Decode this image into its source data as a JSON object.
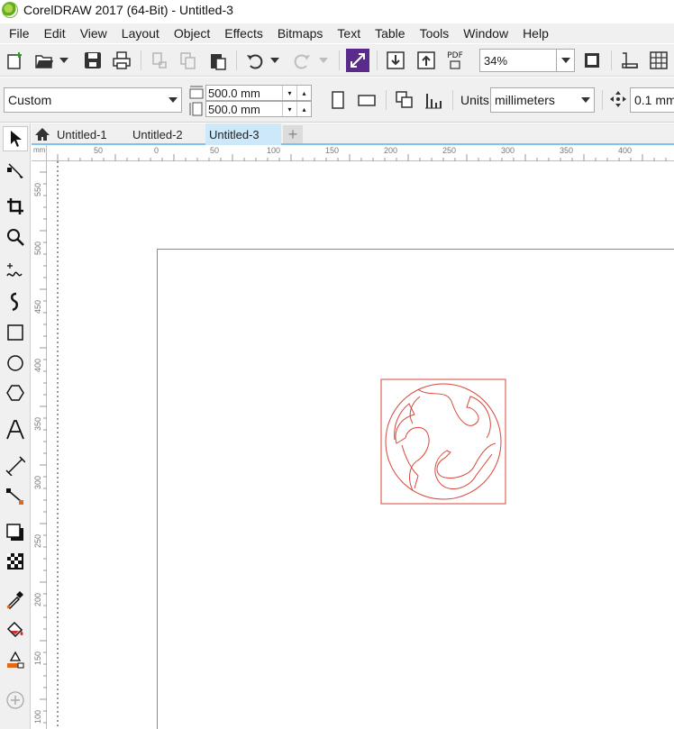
{
  "window": {
    "title": "CorelDRAW 2017 (64-Bit) - Untitled-3"
  },
  "menu": [
    "File",
    "Edit",
    "View",
    "Layout",
    "Object",
    "Effects",
    "Bitmaps",
    "Text",
    "Table",
    "Tools",
    "Window",
    "Help"
  ],
  "toolbar": {
    "pdf_label": "PDF",
    "zoom": "34%"
  },
  "property_bar": {
    "page_size": "Custom",
    "width": "500.0 mm",
    "height": "500.0 mm",
    "units_label": "Units:",
    "units": "millimeters",
    "nudge": "0.1 mm"
  },
  "tabs": [
    {
      "label": "Untitled-1",
      "active": false
    },
    {
      "label": "Untitled-2",
      "active": false
    },
    {
      "label": "Untitled-3",
      "active": true
    }
  ],
  "ruler": {
    "corner": "mm",
    "horizontal": [
      "50",
      "0",
      "50",
      "100",
      "150",
      "200",
      "250",
      "300",
      "350",
      "400"
    ],
    "vertical": [
      "550",
      "500",
      "450",
      "400",
      "350",
      "300",
      "250",
      "200",
      "150",
      "100"
    ]
  },
  "colors": {
    "accent_tab": "#cde8f8",
    "drawing_stroke": "#d9473a",
    "toolbar_bg": "#f0f0f0"
  },
  "icons": {
    "toolbox": [
      "pick-tool-icon",
      "shape-tool-icon",
      "crop-tool-icon",
      "zoom-tool-icon",
      "freehand-tool-icon",
      "artistic-media-icon",
      "rectangle-tool-icon",
      "ellipse-tool-icon",
      "polygon-tool-icon",
      "text-tool-icon",
      "dimension-tool-icon",
      "connector-tool-icon",
      "drop-shadow-icon",
      "transparency-icon",
      "color-eyedropper-icon",
      "interactive-fill-icon",
      "smart-fill-icon",
      "add-tool-icon"
    ]
  }
}
